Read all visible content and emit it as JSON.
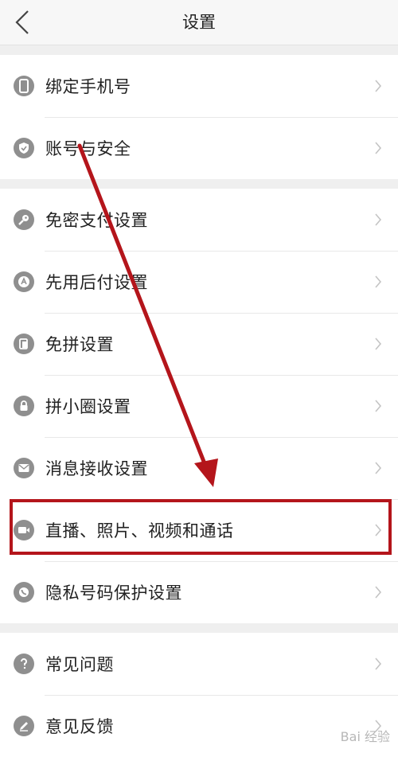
{
  "header": {
    "title": "设置"
  },
  "groups": [
    {
      "items": [
        {
          "label": "绑定手机号",
          "icon": "phone-icon"
        },
        {
          "label": "账号与安全",
          "icon": "shield-icon"
        }
      ]
    },
    {
      "items": [
        {
          "label": "免密支付设置",
          "icon": "key-icon"
        },
        {
          "label": "先用后付设置",
          "icon": "badge-a-icon"
        },
        {
          "label": "免拼设置",
          "icon": "cards-icon"
        },
        {
          "label": "拼小圈设置",
          "icon": "lock-icon"
        },
        {
          "label": "消息接收设置",
          "icon": "mail-icon"
        },
        {
          "label": "直播、照片、视频和通话",
          "icon": "video-icon"
        },
        {
          "label": "隐私号码保护设置",
          "icon": "privacy-phone-icon"
        }
      ]
    },
    {
      "items": [
        {
          "label": "常见问题",
          "icon": "question-icon"
        },
        {
          "label": "意见反馈",
          "icon": "pen-icon"
        }
      ]
    }
  ],
  "watermark": "Bai 经验",
  "colors": {
    "annotation": "#b4151b",
    "icon_bg": "#8f8f8f"
  }
}
